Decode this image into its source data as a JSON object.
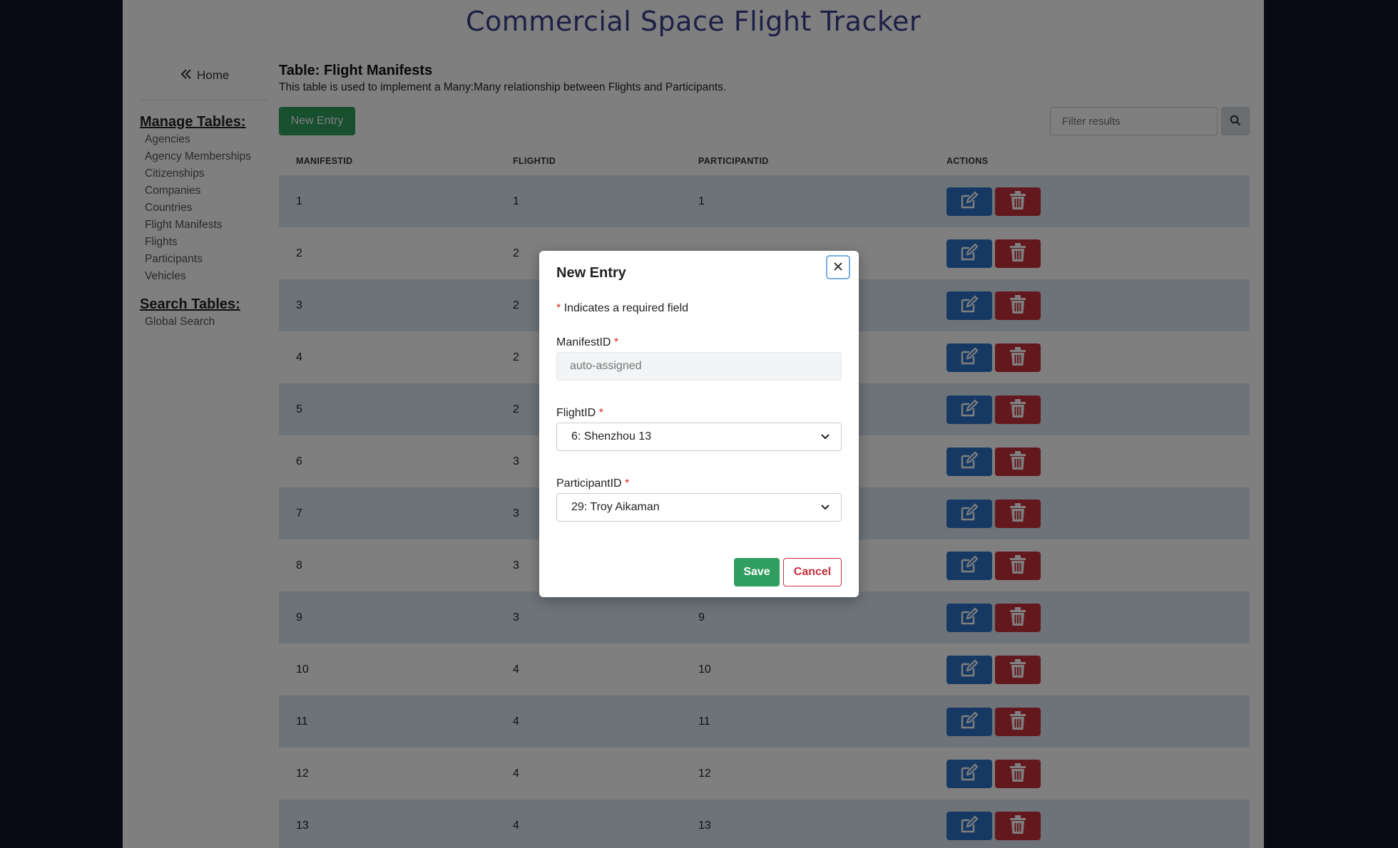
{
  "app": {
    "title": "Commercial Space Flight Tracker"
  },
  "sidebar": {
    "home_label": "Home",
    "manage_heading": "Manage Tables:",
    "manage_items": [
      {
        "label": "Agencies"
      },
      {
        "label": "Agency Memberships"
      },
      {
        "label": "Citizenships"
      },
      {
        "label": "Companies"
      },
      {
        "label": "Countries"
      },
      {
        "label": "Flight Manifests"
      },
      {
        "label": "Flights"
      },
      {
        "label": "Participants"
      },
      {
        "label": "Vehicles"
      }
    ],
    "search_heading": "Search Tables:",
    "search_items": [
      {
        "label": "Global Search"
      }
    ]
  },
  "main": {
    "table_title": "Table: Flight Manifests",
    "table_description": "This table is used to implement a Many:Many relationship between Flights and Participants.",
    "new_entry_label": "New Entry",
    "filter_placeholder": "Filter results",
    "columns": [
      "MANIFESTID",
      "FLIGHTID",
      "PARTICIPANTID",
      "ACTIONS"
    ],
    "rows": [
      {
        "manifest": "1",
        "flight": "1",
        "participant": "1"
      },
      {
        "manifest": "2",
        "flight": "2",
        "participant": ""
      },
      {
        "manifest": "3",
        "flight": "2",
        "participant": ""
      },
      {
        "manifest": "4",
        "flight": "2",
        "participant": ""
      },
      {
        "manifest": "5",
        "flight": "2",
        "participant": ""
      },
      {
        "manifest": "6",
        "flight": "3",
        "participant": ""
      },
      {
        "manifest": "7",
        "flight": "3",
        "participant": ""
      },
      {
        "manifest": "8",
        "flight": "3",
        "participant": ""
      },
      {
        "manifest": "9",
        "flight": "3",
        "participant": "9"
      },
      {
        "manifest": "10",
        "flight": "4",
        "participant": "10"
      },
      {
        "manifest": "11",
        "flight": "4",
        "participant": "11"
      },
      {
        "manifest": "12",
        "flight": "4",
        "participant": "12"
      },
      {
        "manifest": "13",
        "flight": "4",
        "participant": "13"
      }
    ]
  },
  "modal": {
    "title": "New Entry",
    "required_marker": "*",
    "required_note": "Indicates a required field",
    "manifest_label": "ManifestID",
    "manifest_placeholder": "auto-assigned",
    "flight_label": "FlightID",
    "flight_value": "6: Shenzhou 13",
    "participant_label": "ParticipantID",
    "participant_value": "29: Troy Aikaman",
    "save_label": "Save",
    "cancel_label": "Cancel"
  },
  "colors": {
    "brand_title": "#3b3f8c",
    "primary_green": "#2f9e5e",
    "edit_blue": "#2c73c6",
    "delete_red": "#c6303a",
    "row_stripe": "#dbe6f3"
  }
}
